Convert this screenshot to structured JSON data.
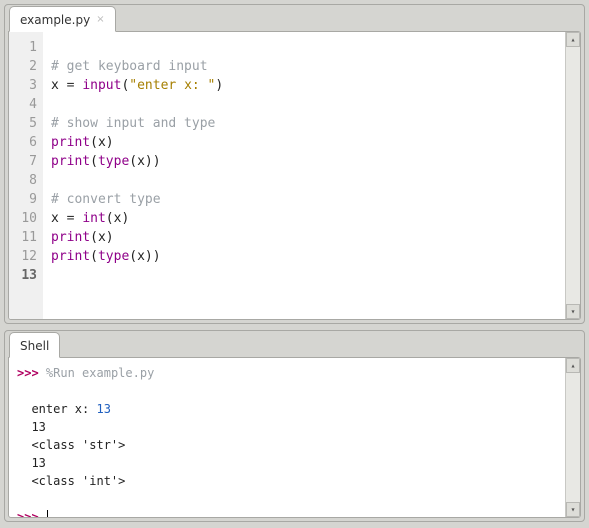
{
  "editor": {
    "tab_label": "example.py",
    "lines": [
      {
        "n": "1",
        "tokens": []
      },
      {
        "n": "2",
        "tokens": [
          {
            "cls": "tok-comment",
            "t": "# get keyboard input"
          }
        ]
      },
      {
        "n": "3",
        "tokens": [
          {
            "cls": "",
            "t": "x "
          },
          {
            "cls": "tok-op",
            "t": "="
          },
          {
            "cls": "",
            "t": " "
          },
          {
            "cls": "tok-builtin",
            "t": "input"
          },
          {
            "cls": "",
            "t": "("
          },
          {
            "cls": "tok-string",
            "t": "\"enter x: \""
          },
          {
            "cls": "",
            "t": ")"
          }
        ]
      },
      {
        "n": "4",
        "tokens": []
      },
      {
        "n": "5",
        "tokens": [
          {
            "cls": "tok-comment",
            "t": "# show input and type"
          }
        ]
      },
      {
        "n": "6",
        "tokens": [
          {
            "cls": "tok-builtin",
            "t": "print"
          },
          {
            "cls": "",
            "t": "(x)"
          }
        ]
      },
      {
        "n": "7",
        "tokens": [
          {
            "cls": "tok-builtin",
            "t": "print"
          },
          {
            "cls": "",
            "t": "("
          },
          {
            "cls": "tok-builtin",
            "t": "type"
          },
          {
            "cls": "",
            "t": "(x))"
          }
        ]
      },
      {
        "n": "8",
        "tokens": []
      },
      {
        "n": "9",
        "tokens": [
          {
            "cls": "tok-comment",
            "t": "# convert type"
          }
        ]
      },
      {
        "n": "10",
        "tokens": [
          {
            "cls": "",
            "t": "x "
          },
          {
            "cls": "tok-op",
            "t": "="
          },
          {
            "cls": "",
            "t": " "
          },
          {
            "cls": "tok-builtin",
            "t": "int"
          },
          {
            "cls": "",
            "t": "(x)"
          }
        ]
      },
      {
        "n": "11",
        "tokens": [
          {
            "cls": "tok-builtin",
            "t": "print"
          },
          {
            "cls": "",
            "t": "(x)"
          }
        ]
      },
      {
        "n": "12",
        "tokens": [
          {
            "cls": "tok-builtin",
            "t": "print"
          },
          {
            "cls": "",
            "t": "("
          },
          {
            "cls": "tok-builtin",
            "t": "type"
          },
          {
            "cls": "",
            "t": "(x))"
          }
        ]
      },
      {
        "n": "13",
        "tokens": [],
        "current": true
      }
    ]
  },
  "shell": {
    "tab_label": "Shell",
    "prompt": ">>>",
    "run_cmd": "%Run example.py",
    "output": [
      {
        "indent": true,
        "pre": "enter x: ",
        "val": "13"
      },
      {
        "indent": true,
        "pre": "13"
      },
      {
        "indent": true,
        "pre": "<class 'str'>"
      },
      {
        "indent": true,
        "pre": "13"
      },
      {
        "indent": true,
        "pre": "<class 'int'>"
      }
    ]
  }
}
